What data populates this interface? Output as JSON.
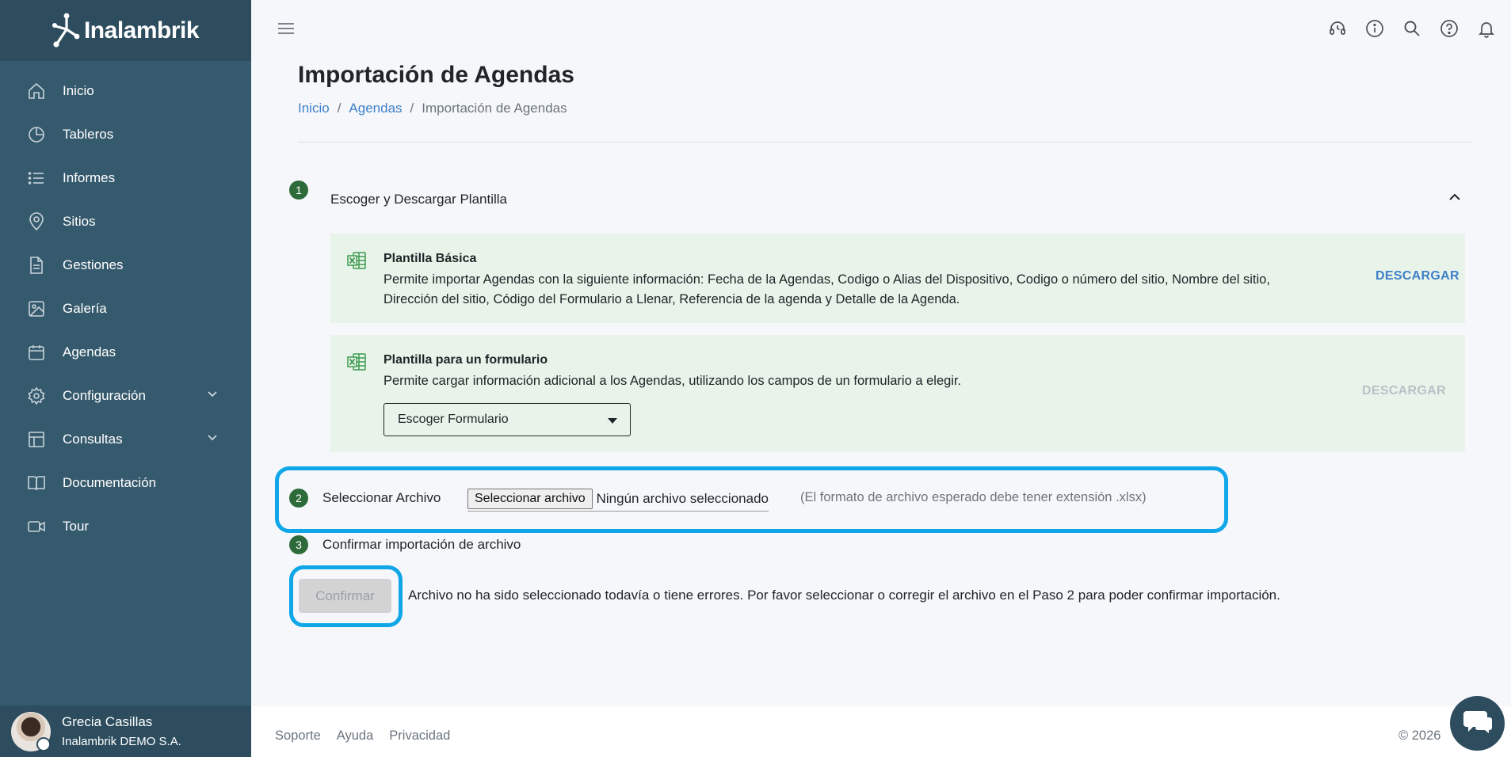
{
  "brand": {
    "name": "Inalambrik"
  },
  "sidebar": {
    "items": [
      {
        "label": "Inicio",
        "icon": "home-icon"
      },
      {
        "label": "Tableros",
        "icon": "pie-chart-icon"
      },
      {
        "label": "Informes",
        "icon": "list-icon"
      },
      {
        "label": "Sitios",
        "icon": "map-pin-icon"
      },
      {
        "label": "Gestiones",
        "icon": "file-text-icon"
      },
      {
        "label": "Galería",
        "icon": "image-icon"
      },
      {
        "label": "Agendas",
        "icon": "calendar-icon"
      },
      {
        "label": "Configuración",
        "icon": "gear-icon"
      },
      {
        "label": "Consultas",
        "icon": "table-icon"
      },
      {
        "label": "Documentación",
        "icon": "book-icon"
      },
      {
        "label": "Tour",
        "icon": "video-icon"
      }
    ]
  },
  "user": {
    "name": "Grecia Casillas",
    "company": "Inalambrik DEMO S.A."
  },
  "page": {
    "title": "Importación de Agendas"
  },
  "breadcrumb": {
    "home": "Inicio",
    "section": "Agendas",
    "current": "Importación de Agendas",
    "separator": "/"
  },
  "steps": {
    "step1": {
      "number": "1",
      "label": "Escoger y Descargar Plantilla",
      "templates": [
        {
          "title": "Plantilla Básica",
          "description": "Permite importar Agendas con la siguiente información: Fecha de la Agendas, Codigo o Alias del Dispositivo, Codigo o número del sitio, Nombre del sitio, Dirección del sitio, Código del Formulario a Llenar, Referencia de la agenda y Detalle de la Agenda.",
          "download_label": "DESCARGAR"
        },
        {
          "title": "Plantilla para un formulario",
          "description": "Permite cargar información adicional a los Agendas, utilizando los campos de un formulario a elegir.",
          "select_value": "Escoger Formulario",
          "download_label": "DESCARGAR"
        }
      ]
    },
    "step2": {
      "number": "2",
      "label": "Seleccionar Archivo",
      "file_button": "Seleccionar archivo",
      "file_status": "Ningún archivo seleccionado",
      "hint": "(El formato de archivo esperado debe tener extensión .xlsx)"
    },
    "step3": {
      "number": "3",
      "label": "Confirmar importación de archivo",
      "button": "Confirmar",
      "message": "Archivo no ha sido seleccionado todavía o tiene errores. Por favor seleccionar o corregir el archivo en el Paso 2 para poder confirmar importación."
    }
  },
  "footer": {
    "links": [
      "Soporte",
      "Ayuda",
      "Privacidad"
    ],
    "copyright": "© 2026"
  },
  "colors": {
    "sidebar": "#365a6d",
    "sidebar_dark": "#2d4d5f",
    "accent": "#3f7fc9",
    "step": "#2e6b3a",
    "card": "#e8f4e9",
    "highlight": "#10a7e8"
  }
}
